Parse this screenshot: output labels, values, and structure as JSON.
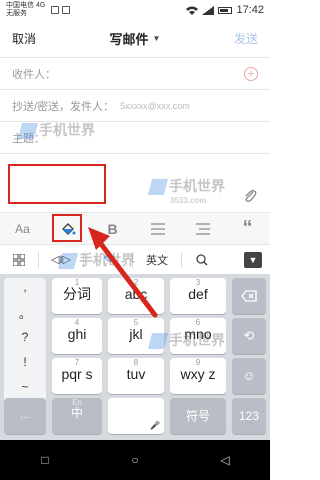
{
  "status_bar": {
    "carrier": "中国电信 4G",
    "network": "无服务",
    "time": "17:42"
  },
  "header": {
    "cancel_label": "取消",
    "title": "写邮件",
    "send_label": "发送"
  },
  "fields": {
    "recipient_label": "收件人：",
    "cc_label": "抄送/密送，发件人：",
    "cc_value": "5xxxxx@xxx.com",
    "subject_label": "主题："
  },
  "format_toolbar": {
    "items": [
      "Aa",
      "fill-color-icon",
      "B",
      "list-icon",
      "align-icon",
      "quote-icon"
    ],
    "aa_label": "Aa",
    "bold_label": "B",
    "quote_label": "“"
  },
  "ime_bar": {
    "lang_label": "英文"
  },
  "keyboard": {
    "left_column": [
      ",",
      "。",
      "?",
      "!",
      "~"
    ],
    "keys_row1": [
      {
        "main": "分词",
        "sub": "1"
      },
      {
        "main": "abc",
        "sub": "2"
      },
      {
        "main": "def",
        "sub": "3"
      }
    ],
    "keys_row2": [
      {
        "main": "ghi",
        "sub": "4"
      },
      {
        "main": "jkl",
        "sub": "5"
      },
      {
        "main": "mno",
        "sub": "6"
      }
    ],
    "keys_row3": [
      {
        "main": "pqr s",
        "sub": "7"
      },
      {
        "main": "tuv",
        "sub": "8"
      },
      {
        "main": "wxy z",
        "sub": "9"
      }
    ],
    "bottom_row": {
      "lang_top": "En",
      "lang_main": "中",
      "symbol": "符号",
      "num": "123"
    }
  },
  "watermarks": {
    "text": "手机世界",
    "num": "3533.com"
  },
  "colors": {
    "highlight_red": "#d7261e",
    "send_disabled": "#a9c6ec",
    "keyboard_bg": "#d6d9de",
    "nav_bg": "#000000"
  }
}
